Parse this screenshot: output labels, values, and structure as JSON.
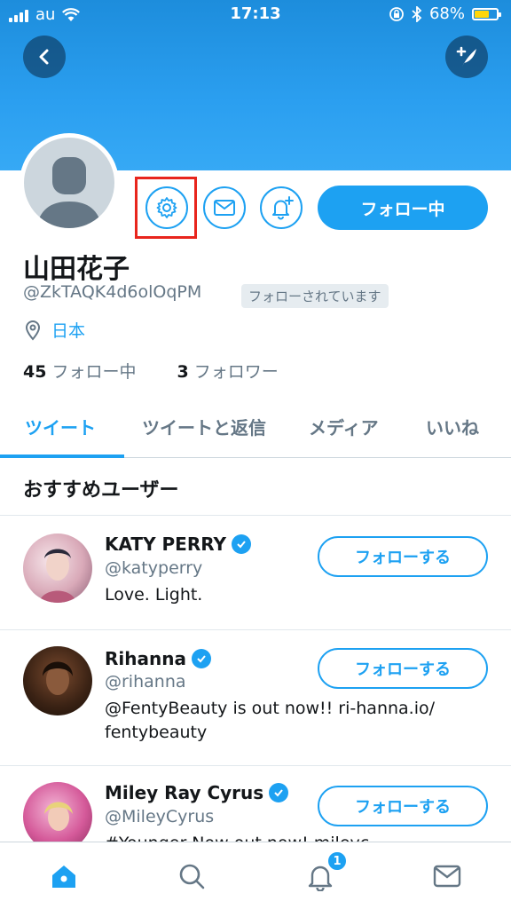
{
  "status": {
    "carrier": "au",
    "time": "17:13",
    "battery": "68%",
    "battery_level": 0.68
  },
  "profile": {
    "name": "山田花子",
    "handle": "@ZkTAQK4d6olOqPM",
    "follows_you": "フォローされています",
    "location": "日本",
    "following_count": "45",
    "following_label": "フォロー中",
    "followers_count": "3",
    "followers_label": "フォロワー",
    "follow_button": "フォロー中"
  },
  "tabs": [
    "ツイート",
    "ツイートと返信",
    "メディア",
    "いいね"
  ],
  "suggestions": {
    "title": "おすすめユーザー",
    "users": [
      {
        "name": "KATY PERRY",
        "handle": "@katyperry",
        "bio": "Love. Light.",
        "button": "フォローする"
      },
      {
        "name": "Rihanna",
        "handle": "@rihanna",
        "bio": "@FentyBeauty is out now!! ri-hanna.io/ fentybeauty",
        "button": "フォローする"
      },
      {
        "name": "Miley Ray Cyrus",
        "handle": "@MileyCyrus",
        "bio": "#Younger Now out now! mileyc...",
        "button": "フォローする"
      }
    ]
  },
  "tabbar": {
    "notification_badge": "1"
  },
  "colors": {
    "accent": "#1da1f2",
    "highlight": "#e8251d"
  }
}
